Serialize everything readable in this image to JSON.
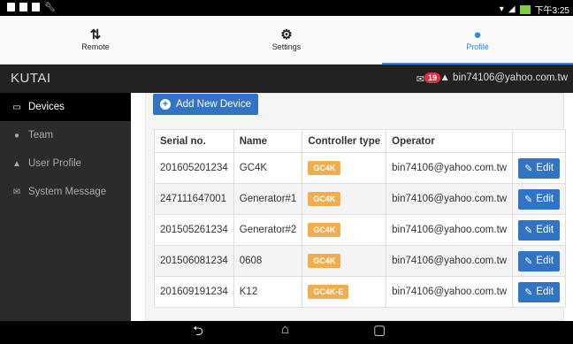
{
  "status_bar": {
    "time": "下午3:25"
  },
  "tabs": [
    {
      "label": "Remote",
      "icon": "sort-arrows-icon"
    },
    {
      "label": "Settings",
      "icon": "gear-icon"
    },
    {
      "label": "Profile",
      "icon": "person-icon"
    }
  ],
  "header": {
    "brand": "KUTAI",
    "message_count": "19",
    "user_email": "bin74106@yahoo.com.tw"
  },
  "sidebar": {
    "items": [
      {
        "label": "Devices",
        "icon": "laptop-icon"
      },
      {
        "label": "Team",
        "icon": "users-icon"
      },
      {
        "label": "User Profile",
        "icon": "user-icon"
      },
      {
        "label": "System Message",
        "icon": "envelope-icon"
      }
    ]
  },
  "main": {
    "add_button": "Add New Device",
    "table": {
      "headers": [
        "Serial no.",
        "Name",
        "Controller type",
        "Operator",
        ""
      ],
      "rows": [
        {
          "serial": "201605201234",
          "name": "GC4K",
          "controller": "GC4K",
          "operator": "bin74106@yahoo.com.tw",
          "action": "Edit"
        },
        {
          "serial": "247111647001",
          "name": "Generator#1",
          "controller": "GC4K",
          "operator": "bin74106@yahoo.com.tw",
          "action": "Edit"
        },
        {
          "serial": "201505261234",
          "name": "Generator#2",
          "controller": "GC4K",
          "operator": "bin74106@yahoo.com.tw",
          "action": "Edit"
        },
        {
          "serial": "201506081234",
          "name": "0608",
          "controller": "GC4K",
          "operator": "bin74106@yahoo.com.tw",
          "action": "Edit"
        },
        {
          "serial": "201609191234",
          "name": "K12",
          "controller": "GC4K-E",
          "operator": "bin74106@yahoo.com.tw",
          "action": "Edit"
        }
      ]
    }
  },
  "colors": {
    "primary": "#3173c4",
    "label_orange": "#f0ad4e",
    "badge_red": "#d9333f",
    "tab_active": "#2a8ae6"
  }
}
